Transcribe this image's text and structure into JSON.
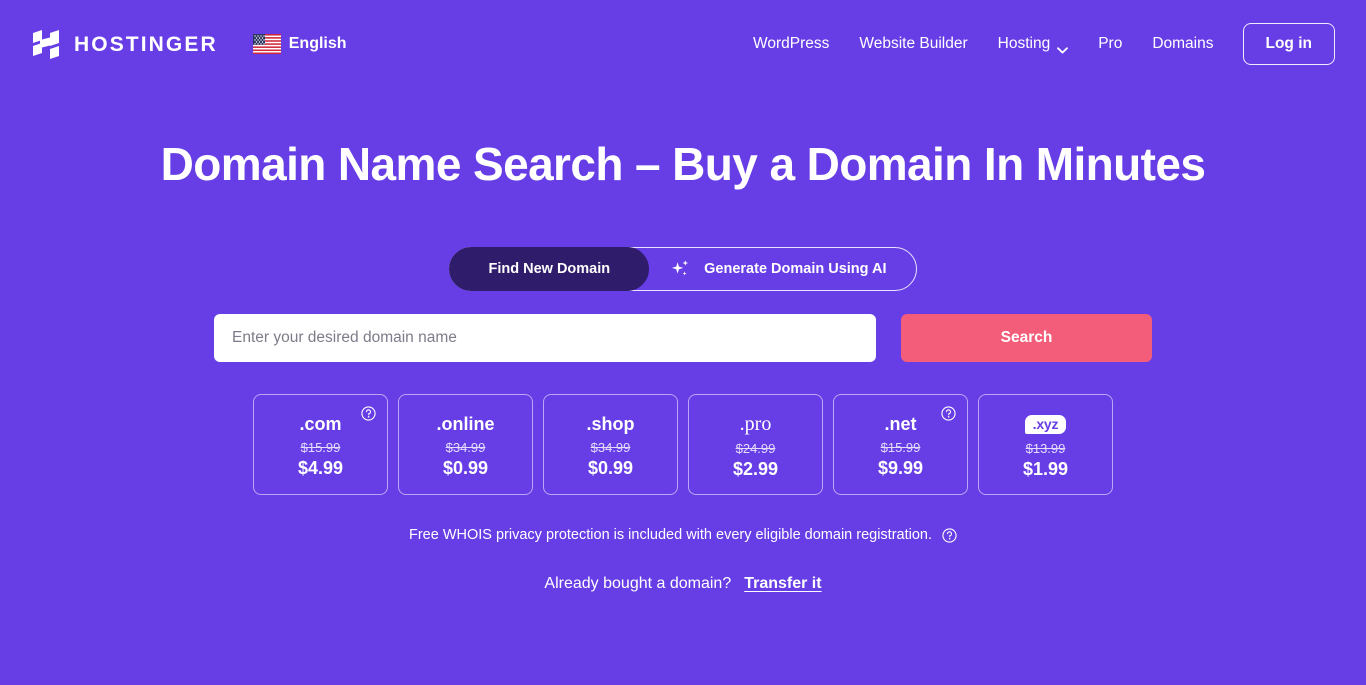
{
  "theme": {
    "background": "#673de6",
    "accent_pink": "#f45d7a",
    "dark_purple": "#2f1c6a",
    "text": "#ffffff"
  },
  "header": {
    "logo_text": "HOSTINGER",
    "logo_icon": "hostinger-h-logo",
    "language": {
      "flag_icon": "us-flag-icon",
      "label": "English"
    },
    "nav": [
      {
        "label": "WordPress",
        "has_chevron": false
      },
      {
        "label": "Website Builder",
        "has_chevron": false
      },
      {
        "label": "Hosting",
        "has_chevron": true
      },
      {
        "label": "Pro",
        "has_chevron": false
      },
      {
        "label": "Domains",
        "has_chevron": false
      }
    ],
    "login_label": "Log in"
  },
  "hero": {
    "title": "Domain Name Search – Buy a Domain In Minutes"
  },
  "tabs": [
    {
      "label": "Find New Domain",
      "active": true,
      "icon": null
    },
    {
      "label": "Generate Domain Using AI",
      "active": false,
      "icon": "sparkle-icon"
    }
  ],
  "search": {
    "placeholder": "Enter your desired domain name",
    "value": "",
    "button_label": "Search"
  },
  "tlds": [
    {
      "name": ".com",
      "style": "bold",
      "old_price": "$15.99",
      "new_price": "$4.99",
      "help": true
    },
    {
      "name": ".online",
      "style": "bold",
      "old_price": "$34.99",
      "new_price": "$0.99",
      "help": false
    },
    {
      "name": ".shop",
      "style": "bold",
      "old_price": "$34.99",
      "new_price": "$0.99",
      "help": false
    },
    {
      "name": ".pro",
      "style": "serif",
      "old_price": "$24.99",
      "new_price": "$2.99",
      "help": false
    },
    {
      "name": ".net",
      "style": "bold",
      "old_price": "$15.99",
      "new_price": "$9.99",
      "help": true
    },
    {
      "name": ".xyz",
      "style": "badge",
      "old_price": "$13.99",
      "new_price": "$1.99",
      "help": false
    }
  ],
  "whois": {
    "text": "Free WHOIS privacy protection is included with every eligible domain registration.",
    "help_icon": "question-circle-icon"
  },
  "transfer": {
    "text": "Already bought a domain?",
    "link_label": "Transfer it"
  }
}
